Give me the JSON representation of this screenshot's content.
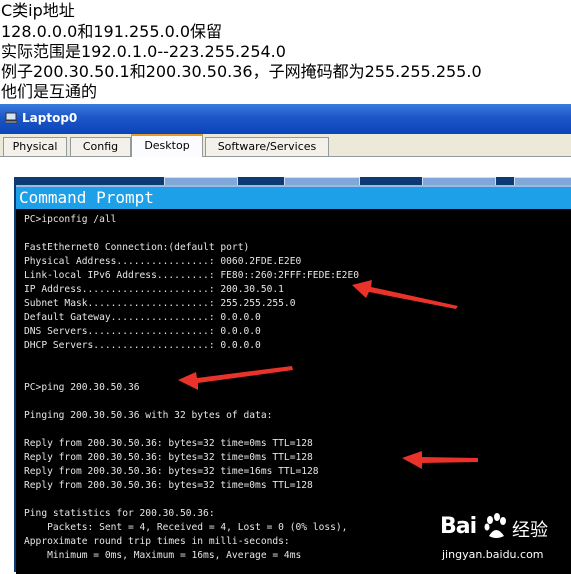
{
  "notes": [
    "C类ip地址",
    "128.0.0.0和191.255.0.0保留",
    "实际范围是192.0.1.0--223.255.254.0",
    "例子200.30.50.1和200.30.50.36，子网掩码都为255.255.255.0",
    "他们是互通的"
  ],
  "window": {
    "title": "Laptop0",
    "tabs": [
      "Physical",
      "Config",
      "Desktop",
      "Software/Services"
    ],
    "active_tab": "Desktop"
  },
  "command_prompt": {
    "title": "Command Prompt",
    "lines": [
      "PC>ipconfig /all",
      "",
      "FastEthernet0 Connection:(default port)",
      "Physical Address................: 0060.2FDE.E2E0",
      "Link-local IPv6 Address.........: FE80::260:2FFF:FEDE:E2E0",
      "IP Address......................: 200.30.50.1",
      "Subnet Mask.....................: 255.255.255.0",
      "Default Gateway.................: 0.0.0.0",
      "DNS Servers.....................: 0.0.0.0",
      "DHCP Servers....................: 0.0.0.0",
      "",
      "",
      "PC>ping 200.30.50.36",
      "",
      "Pinging 200.30.50.36 with 32 bytes of data:",
      "",
      "Reply from 200.30.50.36: bytes=32 time=0ms TTL=128",
      "Reply from 200.30.50.36: bytes=32 time=0ms TTL=128",
      "Reply from 200.30.50.36: bytes=32 time=16ms TTL=128",
      "Reply from 200.30.50.36: bytes=32 time=0ms TTL=128",
      "",
      "Ping statistics for 200.30.50.36:",
      "    Packets: Sent = 4, Received = 4, Lost = 0 (0% loss),",
      "Approximate round trip times in milli-seconds:",
      "    Minimum = 0ms, Maximum = 16ms, Average = 4ms"
    ]
  },
  "watermark": {
    "brand": "Bai",
    "brand_suffix": "经验",
    "url": "jingyan.baidu.com"
  },
  "colors": {
    "annotation_arrow": "#e8322a",
    "cmd_title_bar": "#1ea0e8",
    "window_title_bar": "#0a44b8"
  }
}
